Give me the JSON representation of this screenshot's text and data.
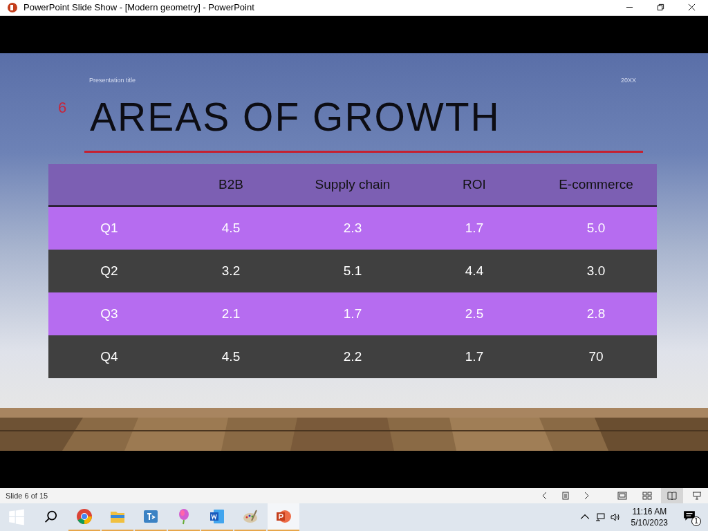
{
  "window": {
    "title": "PowerPoint Slide Show - [Modern geometry] - PowerPoint"
  },
  "slide": {
    "presentation_title": "Presentation title",
    "year": "20XX",
    "number": "6",
    "title": "AREAS OF GROWTH",
    "table": {
      "columns": [
        "",
        "B2B",
        "Supply chain",
        "ROI",
        "E-commerce"
      ],
      "rows": [
        [
          "Q1",
          "4.5",
          "2.3",
          "1.7",
          "5.0"
        ],
        [
          "Q2",
          "3.2",
          "5.1",
          "4.4",
          "3.0"
        ],
        [
          "Q3",
          "2.1",
          "1.7",
          "2.5",
          "2.8"
        ],
        [
          "Q4",
          "4.5",
          "2.2",
          "1.7",
          "70"
        ]
      ]
    }
  },
  "status_bar": {
    "slide_counter": "Slide 6 of 15",
    "views": [
      {
        "kind": "normal",
        "selected": false
      },
      {
        "kind": "sorter",
        "selected": false
      },
      {
        "kind": "reading",
        "selected": true
      },
      {
        "kind": "show",
        "selected": false
      }
    ]
  },
  "taskbar": {
    "apps": [
      {
        "kind": "chrome",
        "active": false
      },
      {
        "kind": "explorer",
        "active": false
      },
      {
        "kind": "teams",
        "active": false
      },
      {
        "kind": "paint3d",
        "active": false
      },
      {
        "kind": "word",
        "active": false
      },
      {
        "kind": "paint",
        "active": false
      },
      {
        "kind": "powerpoint",
        "active": true
      }
    ],
    "time": "11:16 AM",
    "date": "5/10/2023",
    "notifications": "1"
  }
}
